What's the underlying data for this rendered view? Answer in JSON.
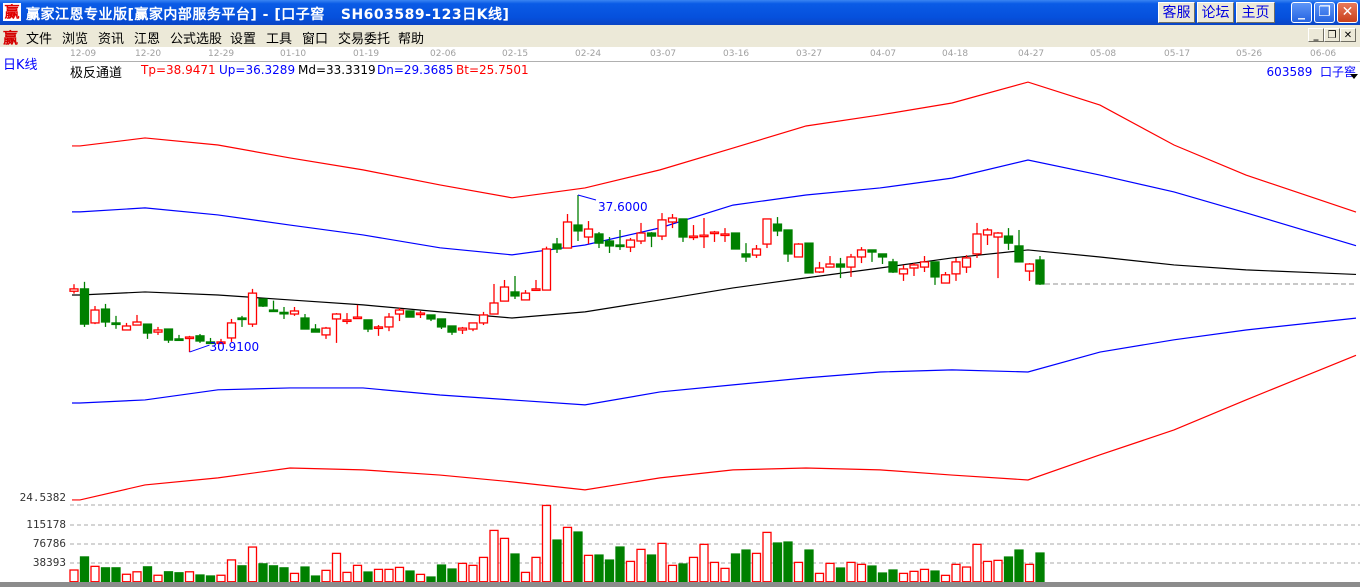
{
  "window": {
    "title": "赢家江恩专业版[赢家内部服务平台] - [口子窖   SH603589-123日K线]",
    "logo": "赢",
    "buttons": [
      "客服",
      "论坛",
      "主页"
    ],
    "controls": [
      "minimize-icon",
      "restore-icon",
      "close-icon"
    ]
  },
  "menu": {
    "logo": "赢",
    "items": [
      "文件",
      "浏览",
      "资讯",
      "江恩",
      "公式选股",
      "设置",
      "工具",
      "窗口",
      "交易委托",
      "帮助"
    ]
  },
  "chart": {
    "period": "日K线",
    "stock_tag": "603589  口子窖",
    "indicator": {
      "name": "极反通道",
      "tp": "Tp=38.9471",
      "up": "Up=36.3289",
      "md": "Md=33.3319",
      "dn": "Dn=29.3685",
      "bt": "Bt=25.7501"
    },
    "colors": {
      "up": "#ff0000",
      "down": "#008000",
      "tp": "#ff0000",
      "upper": "#0000ff",
      "mid": "#000000",
      "lower": "#0000ff",
      "bt": "#ff0000"
    },
    "date_ticks": [
      "12-09",
      "12-20",
      "12-29",
      "01-10",
      "01-19",
      "02-06",
      "02-15",
      "02-24",
      "03-07",
      "03-16",
      "03-27",
      "04-07",
      "04-18",
      "04-27",
      "05-08",
      "05-17",
      "05-26",
      "06-06"
    ],
    "annotations": {
      "high": "37.6000",
      "low": "30.9100"
    },
    "volume_ticks": [
      "24.5382",
      "115178",
      "76786",
      "38393"
    ]
  },
  "chart_data": {
    "type": "candlestick",
    "candle_fields": [
      "open",
      "high",
      "low",
      "close"
    ],
    "candles": [
      [
        33.5,
        33.8,
        33.4,
        33.6
      ],
      [
        33.6,
        33.9,
        31.98,
        32.1
      ],
      [
        32.15,
        32.87,
        32.1,
        32.7
      ],
      [
        32.74,
        32.96,
        31.98,
        32.19
      ],
      [
        32.15,
        32.45,
        31.9,
        32.1
      ],
      [
        31.85,
        32.15,
        31.85,
        32.02
      ],
      [
        32.06,
        32.49,
        32.06,
        32.19
      ],
      [
        32.1,
        32.1,
        31.47,
        31.72
      ],
      [
        31.76,
        31.98,
        31.64,
        31.85
      ],
      [
        31.89,
        31.89,
        31.3,
        31.42
      ],
      [
        31.47,
        31.64,
        31.43,
        31.43
      ],
      [
        31.51,
        31.6,
        30.91,
        31.55
      ],
      [
        31.6,
        31.68,
        31.3,
        31.38
      ],
      [
        31.34,
        31.51,
        31.25,
        31.3
      ],
      [
        31.3,
        31.47,
        31.25,
        31.34
      ],
      [
        31.51,
        32.32,
        31.34,
        32.15
      ],
      [
        32.36,
        32.45,
        31.98,
        32.3
      ],
      [
        32.1,
        33.6,
        31.98,
        33.42
      ],
      [
        33.17,
        33.17,
        32.83,
        32.87
      ],
      [
        32.7,
        33.1,
        32.66,
        32.66
      ],
      [
        32.6,
        32.83,
        32.32,
        32.57
      ],
      [
        32.53,
        32.83,
        32.45,
        32.66
      ],
      [
        32.36,
        32.53,
        31.89,
        31.89
      ],
      [
        31.89,
        32.1,
        31.76,
        31.76
      ],
      [
        31.64,
        31.98,
        31.47,
        31.93
      ],
      [
        32.32,
        32.57,
        31.3,
        32.53
      ],
      [
        32.23,
        32.57,
        32.1,
        32.28
      ],
      [
        32.36,
        32.92,
        32.36,
        32.4
      ],
      [
        32.28,
        32.28,
        31.76,
        31.89
      ],
      [
        31.93,
        32.06,
        31.6,
        31.98
      ],
      [
        31.98,
        32.57,
        31.8,
        32.4
      ],
      [
        32.53,
        32.79,
        32.23,
        32.7
      ],
      [
        32.66,
        32.66,
        32.4,
        32.4
      ],
      [
        32.53,
        32.66,
        32.36,
        32.57
      ],
      [
        32.49,
        32.49,
        32.23,
        32.32
      ],
      [
        32.32,
        32.32,
        31.89,
        31.98
      ],
      [
        32.02,
        32.02,
        31.64,
        31.76
      ],
      [
        31.85,
        31.98,
        31.68,
        31.93
      ],
      [
        31.89,
        32.15,
        31.8,
        32.15
      ],
      [
        32.15,
        32.62,
        32.06,
        32.49
      ],
      [
        32.53,
        33.81,
        32.53,
        33.0
      ],
      [
        33.08,
        33.98,
        33.08,
        33.68
      ],
      [
        33.47,
        34.15,
        33.17,
        33.3
      ],
      [
        33.13,
        33.55,
        33.13,
        33.42
      ],
      [
        33.55,
        33.98,
        33.51,
        33.6
      ],
      [
        33.55,
        35.4,
        33.55,
        35.3
      ],
      [
        35.51,
        35.77,
        35.13,
        35.3
      ],
      [
        35.34,
        36.79,
        35.34,
        36.45
      ],
      [
        36.32,
        37.6,
        35.64,
        36.07
      ],
      [
        35.81,
        36.49,
        35.51,
        36.15
      ],
      [
        35.94,
        36.02,
        35.34,
        35.55
      ],
      [
        35.64,
        35.81,
        35.13,
        35.43
      ],
      [
        35.47,
        36.11,
        35.26,
        35.43
      ],
      [
        35.38,
        35.77,
        35.17,
        35.68
      ],
      [
        35.64,
        36.41,
        35.51,
        35.98
      ],
      [
        35.98,
        36.02,
        35.38,
        35.85
      ],
      [
        35.85,
        36.83,
        35.68,
        36.54
      ],
      [
        36.45,
        36.79,
        36.19,
        36.62
      ],
      [
        36.58,
        36.58,
        35.6,
        35.81
      ],
      [
        35.81,
        36.32,
        35.68,
        35.85
      ],
      [
        35.85,
        36.62,
        35.34,
        35.89
      ],
      [
        36.0,
        36.07,
        35.6,
        36.02
      ],
      [
        35.9,
        36.19,
        35.6,
        35.94
      ],
      [
        35.98,
        35.98,
        35.3,
        35.3
      ],
      [
        35.09,
        35.55,
        34.75,
        34.96
      ],
      [
        35.04,
        35.47,
        34.92,
        35.3
      ],
      [
        35.51,
        36.58,
        35.34,
        36.58
      ],
      [
        36.36,
        36.66,
        35.85,
        36.07
      ],
      [
        36.11,
        36.11,
        34.75,
        35.09
      ],
      [
        34.96,
        35.55,
        34.96,
        35.51
      ],
      [
        35.55,
        35.55,
        34.28,
        34.28
      ],
      [
        34.32,
        34.75,
        34.28,
        34.49
      ],
      [
        34.53,
        35.0,
        34.53,
        34.66
      ],
      [
        34.66,
        34.92,
        34.06,
        34.53
      ],
      [
        34.53,
        35.09,
        34.11,
        34.96
      ],
      [
        34.96,
        35.38,
        34.7,
        35.26
      ],
      [
        35.26,
        35.26,
        34.75,
        35.17
      ],
      [
        35.09,
        35.09,
        34.66,
        34.96
      ],
      [
        34.75,
        34.88,
        34.28,
        34.32
      ],
      [
        34.24,
        34.62,
        33.94,
        34.45
      ],
      [
        34.49,
        34.7,
        34.15,
        34.62
      ],
      [
        34.53,
        35.0,
        34.32,
        34.75
      ],
      [
        34.75,
        34.75,
        33.77,
        34.11
      ],
      [
        33.85,
        34.32,
        33.85,
        34.2
      ],
      [
        34.24,
        34.92,
        33.94,
        34.75
      ],
      [
        34.53,
        35.04,
        34.28,
        34.92
      ],
      [
        35.09,
        36.41,
        34.92,
        35.94
      ],
      [
        35.9,
        36.19,
        35.47,
        36.11
      ],
      [
        35.81,
        36.02,
        34.06,
        35.98
      ],
      [
        35.85,
        36.19,
        35.26,
        35.55
      ],
      [
        35.43,
        36.11,
        34.75,
        34.75
      ],
      [
        34.36,
        34.7,
        33.94,
        34.66
      ],
      [
        34.83,
        35.0,
        33.77,
        33.81
      ]
    ],
    "volume": [
      23600,
      50000,
      31000,
      28000,
      28000,
      15000,
      20000,
      30000,
      13000,
      20000,
      18000,
      20000,
      13500,
      11500,
      13000,
      44000,
      32000,
      70000,
      36000,
      32000,
      28000,
      16800,
      29600,
      11400,
      22900,
      57200,
      18800,
      33000,
      19500,
      24900,
      24900,
      28900,
      21500,
      14800,
      9400,
      33600,
      25600,
      37000,
      33000,
      49100,
      103600,
      87500,
      55900,
      18800,
      49100,
      154000,
      84100,
      109700,
      100300,
      53200,
      53800,
      43700,
      70000,
      41000,
      65300,
      53800,
      77400,
      33000,
      35700,
      49100,
      75400,
      39000,
      26900,
      55900,
      63900,
      57200,
      99600,
      78100,
      80100,
      39000,
      63900,
      16800,
      37000,
      27600,
      39000,
      35000,
      31600,
      17500,
      23600,
      16800,
      20900,
      24900,
      21500,
      12800,
      35000,
      29600,
      75400,
      41000,
      43100,
      49800,
      63900,
      35000,
      57900
    ],
    "channel_at_ticks": {
      "dates": [
        "12-09",
        "12-20",
        "12-29",
        "01-10",
        "01-19",
        "02-06",
        "02-15",
        "02-24",
        "03-07",
        "03-16",
        "03-27",
        "04-07",
        "04-18",
        "04-27",
        "05-08",
        "05-17",
        "05-26",
        "06-06"
      ],
      "Tp": [
        39.69,
        40.03,
        39.73,
        39.18,
        38.67,
        38.03,
        37.48,
        37.9,
        38.67,
        39.6,
        40.54,
        41.01,
        41.52,
        42.41,
        41.43,
        39.73,
        38.45,
        37.39
      ],
      "Up": [
        36.88,
        37.05,
        36.75,
        36.32,
        35.9,
        35.35,
        35.05,
        35.47,
        36.2,
        37.17,
        37.6,
        37.9,
        38.32,
        39.09,
        38.45,
        37.73,
        36.84,
        35.9
      ],
      "Md": [
        33.34,
        33.47,
        33.34,
        33.13,
        32.92,
        32.62,
        32.36,
        32.62,
        33.13,
        33.64,
        34.07,
        34.49,
        34.92,
        35.26,
        34.96,
        34.62,
        34.41,
        34.28
      ],
      "Dn": [
        28.74,
        28.87,
        29.3,
        29.38,
        29.38,
        29.08,
        28.87,
        28.66,
        29.21,
        29.51,
        29.81,
        30.06,
        30.15,
        30.06,
        30.91,
        31.43,
        31.85,
        32.19
      ],
      "Bt": [
        24.61,
        25.25,
        25.55,
        25.97,
        25.89,
        25.67,
        25.38,
        25.04,
        25.55,
        25.89,
        25.97,
        25.89,
        25.67,
        25.46,
        26.53,
        27.59,
        28.87,
        30.15
      ]
    },
    "price_min_label": 24.5382,
    "volume_axis": [
      38393,
      76786,
      115178
    ],
    "high_marker": 37.6,
    "low_marker": 30.91
  }
}
